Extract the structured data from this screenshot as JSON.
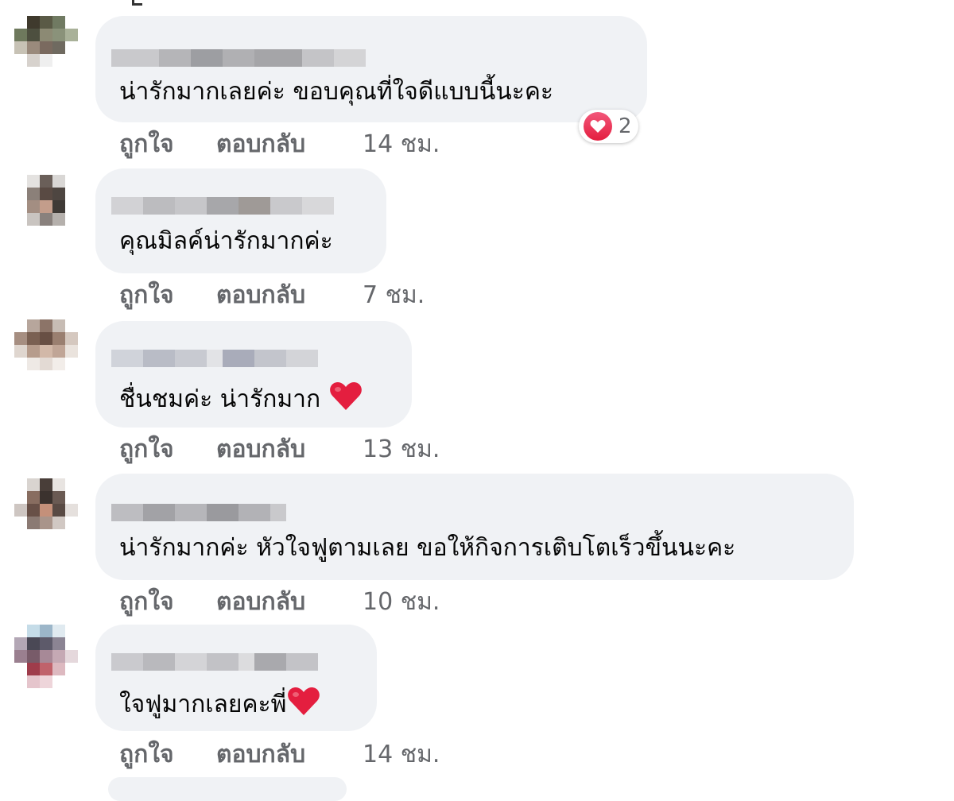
{
  "comments": [
    {
      "text": "น่ารักมากเลยค่ะ ขอบคุณที่ใจดีแบบนี้นะคะ",
      "like": "ถูกใจ",
      "reply": "ตอบกลับ",
      "time": "14 ชม.",
      "reaction_count": "2"
    },
    {
      "text": "คุณมิลค์น่ารักมากค่ะ",
      "like": "ถูกใจ",
      "reply": "ตอบกลับ",
      "time": "7 ชม."
    },
    {
      "text": "ชื่นชมค่ะ น่ารักมาก",
      "like": "ถูกใจ",
      "reply": "ตอบกลับ",
      "time": "13 ชม."
    },
    {
      "text": "น่ารักมากค่ะ หัวใจฟูตามเลย ขอให้กิจการเติบโตเร็วขึ้นนะคะ",
      "like": "ถูกใจ",
      "reply": "ตอบกลับ",
      "time": "10 ชม."
    },
    {
      "text": "ใจฟูมากเลยคะพี่",
      "like": "ถูกใจ",
      "reply": "ตอบกลับ",
      "time": "14 ชม."
    }
  ],
  "icons": {
    "reaction": "heart-reaction-icon",
    "emoji": "red-heart-emoji"
  },
  "colors": {
    "bubble_bg": "#f0f2f5",
    "secondary_text": "#65676b",
    "heart_red": "#e41e3f"
  }
}
